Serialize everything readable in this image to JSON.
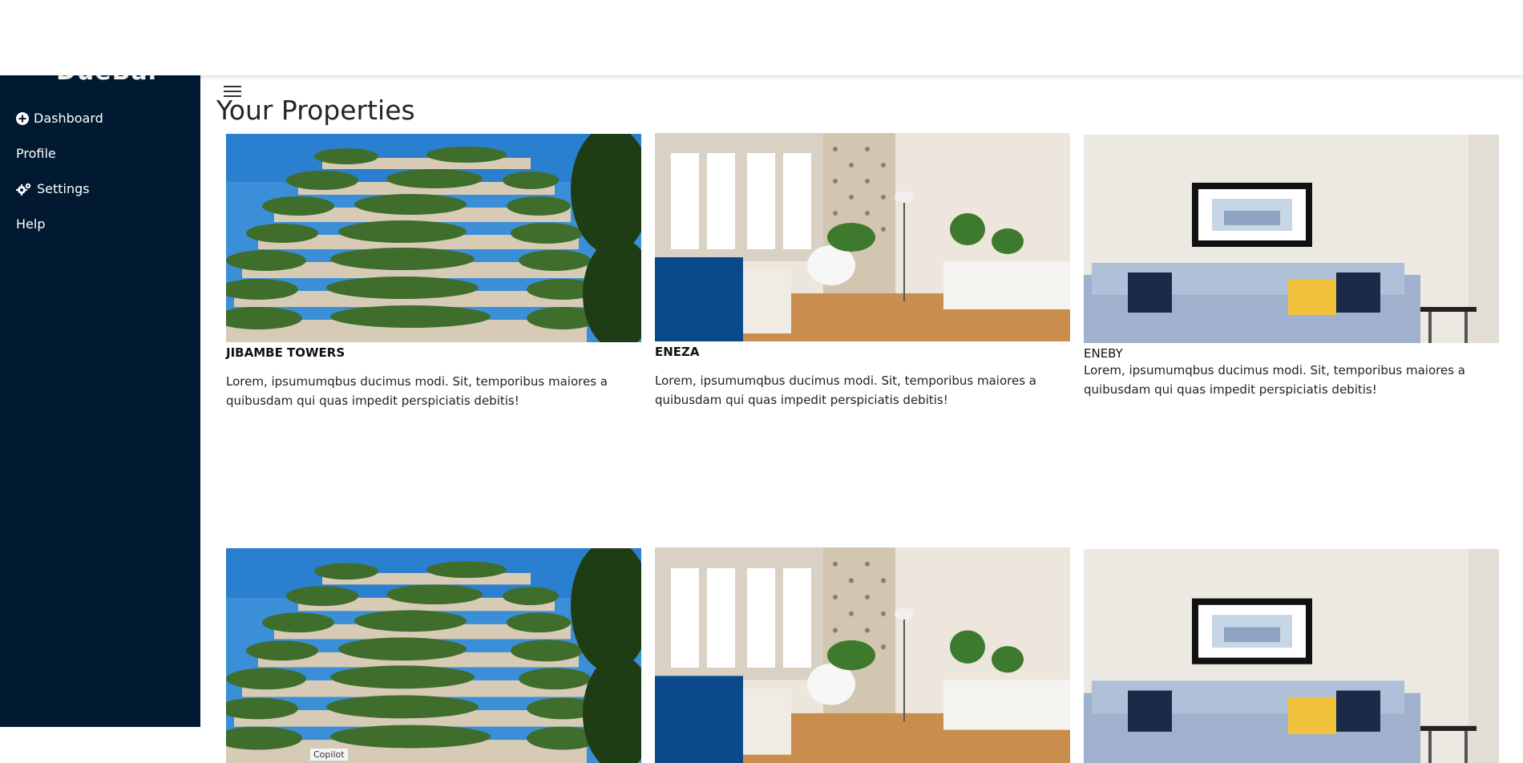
{
  "sidebar": {
    "brand": "DueBar",
    "items": [
      {
        "label": "Dashboard",
        "icon": "plus-circle-icon"
      },
      {
        "label": "Profile",
        "icon": ""
      },
      {
        "label": "Settings",
        "icon": "gears-icon"
      },
      {
        "label": "Help",
        "icon": ""
      }
    ]
  },
  "main": {
    "menu_icon": "hamburger-icon",
    "title": "Your Properties",
    "properties": [
      {
        "name": "JIBAMBE TOWERS",
        "image": "vertical-forest-building",
        "description": "Lorem, ipsumumqbus ducimus modi. Sit, temporibus maiores a quibusdam qui quas impedit perspiciatis debitis!"
      },
      {
        "name": "ENEZA",
        "image": "living-room-windows",
        "description": "Lorem, ipsumumqbus ducimus modi. Sit, temporibus maiores a quibusdam qui quas impedit perspiciatis debitis!"
      },
      {
        "name": "ENEBY",
        "image": "sofa-living-room",
        "description": "Lorem, ipsumumqbus ducimus modi. Sit, temporibus maiores a quibusdam qui quas impedit perspiciatis debitis!"
      }
    ]
  },
  "tooltip": {
    "label": "Copilot"
  }
}
